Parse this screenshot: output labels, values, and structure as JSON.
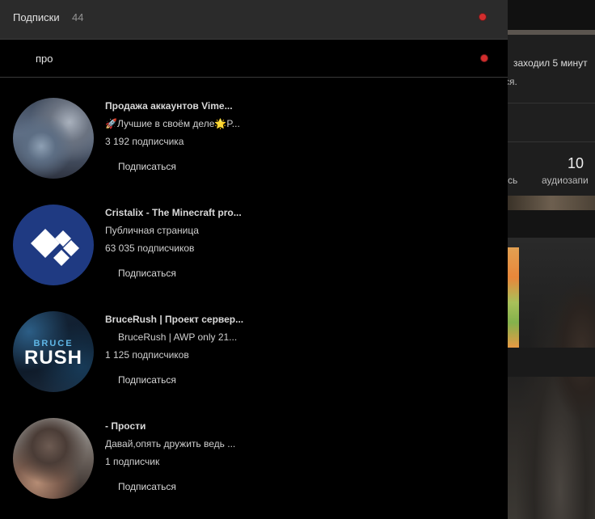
{
  "background": {
    "status_text": "заходил 5 минут",
    "status_text_cont": "ся.",
    "stat_value": "10",
    "stat_label_cut": "сь",
    "stat_label": "аудиозапи"
  },
  "panel": {
    "title": "Подписки",
    "count": "44",
    "search": {
      "value": "про"
    },
    "subscribe_label": "Подписаться",
    "items": [
      {
        "name": "Продажа аккаунтов Vime...",
        "desc": "🚀Лучшие в своём деле🌟P...",
        "subs": "3 192 подписчика"
      },
      {
        "name": "Cristalix - The Minecraft pro...",
        "desc": "Публичная страница",
        "subs": "63 035 подписчиков"
      },
      {
        "name": "BruceRush | Проект сервер...",
        "desc": "BruceRush | AWP only 21...",
        "subs": "1 125 подписчиков",
        "logo_top": "BRUCE",
        "logo_main": "RUSH"
      },
      {
        "name": "- Прости",
        "desc": "Давай,опять дружить ведь ...",
        "subs": "1 подписчик"
      }
    ]
  },
  "colors": {
    "panel_bg": "#000000",
    "header_bg": "#2b2b2b",
    "notify_dot": "#d22d2d",
    "cristalix_blue": "#1f3a82"
  },
  "icons": [
    "notification-dot-icon",
    "cristalix-logo-icon"
  ]
}
